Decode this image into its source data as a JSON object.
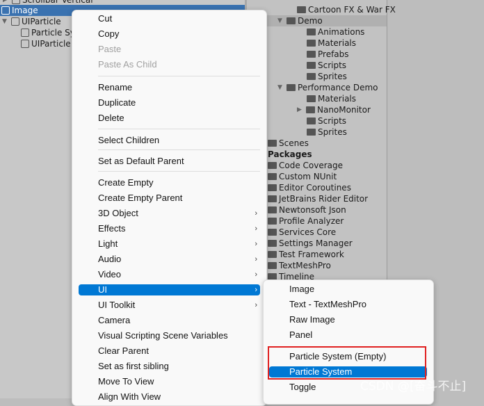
{
  "hierarchy": {
    "items": [
      {
        "label": "Scrollbar Vertical",
        "expanded": false
      },
      {
        "label": "Image",
        "selected": true
      },
      {
        "label": "UIParticle",
        "expanded": true
      },
      {
        "label": "Particle System"
      },
      {
        "label": "UIParticle"
      }
    ]
  },
  "project": {
    "items": [
      {
        "label": "Cartoon FX & War FX"
      },
      {
        "label": "Demo",
        "expanded": true
      },
      {
        "label": "Animations"
      },
      {
        "label": "Materials"
      },
      {
        "label": "Prefabs"
      },
      {
        "label": "Scripts"
      },
      {
        "label": "Sprites"
      },
      {
        "label": "Performance Demo",
        "expanded": true
      },
      {
        "label": "Materials"
      },
      {
        "label": "NanoMonitor"
      },
      {
        "label": "Scripts"
      },
      {
        "label": "Sprites"
      },
      {
        "label": "Scenes"
      },
      {
        "label": "Packages"
      },
      {
        "label": "Code Coverage"
      },
      {
        "label": "Custom NUnit"
      },
      {
        "label": "Editor Coroutines"
      },
      {
        "label": "JetBrains Rider Editor"
      },
      {
        "label": "Newtonsoft Json"
      },
      {
        "label": "Profile Analyzer"
      },
      {
        "label": "Services Core"
      },
      {
        "label": "Settings Manager"
      },
      {
        "label": "Test Framework"
      },
      {
        "label": "TextMeshPro"
      },
      {
        "label": "Timeline"
      }
    ]
  },
  "context_menu": {
    "items": [
      {
        "label": "Cut"
      },
      {
        "label": "Copy"
      },
      {
        "label": "Paste",
        "disabled": true
      },
      {
        "label": "Paste As Child",
        "disabled": true
      },
      {
        "label": "Rename"
      },
      {
        "label": "Duplicate"
      },
      {
        "label": "Delete"
      },
      {
        "label": "Select Children"
      },
      {
        "label": "Set as Default Parent"
      },
      {
        "label": "Create Empty"
      },
      {
        "label": "Create Empty Parent"
      },
      {
        "label": "3D Object",
        "submenu": true
      },
      {
        "label": "Effects",
        "submenu": true
      },
      {
        "label": "Light",
        "submenu": true
      },
      {
        "label": "Audio",
        "submenu": true
      },
      {
        "label": "Video",
        "submenu": true
      },
      {
        "label": "UI",
        "submenu": true,
        "highlighted": true
      },
      {
        "label": "UI Toolkit",
        "submenu": true
      },
      {
        "label": "Camera"
      },
      {
        "label": "Visual Scripting Scene Variables"
      },
      {
        "label": "Clear Parent"
      },
      {
        "label": "Set as first sibling"
      },
      {
        "label": "Move To View"
      },
      {
        "label": "Align With View"
      }
    ],
    "arrow": "›"
  },
  "ui_submenu": {
    "items": [
      {
        "label": "Image"
      },
      {
        "label": "Text - TextMeshPro"
      },
      {
        "label": "Raw Image"
      },
      {
        "label": "Panel"
      },
      {
        "label": "Particle System (Empty)"
      },
      {
        "label": "Particle System",
        "highlighted": true
      },
      {
        "label": "Toggle"
      }
    ]
  },
  "watermark": "CSDN @[奋斗不止]",
  "colors": {
    "selection": "#3a72b0",
    "menu_highlight": "#0078d4",
    "annotation": "#e02020"
  }
}
